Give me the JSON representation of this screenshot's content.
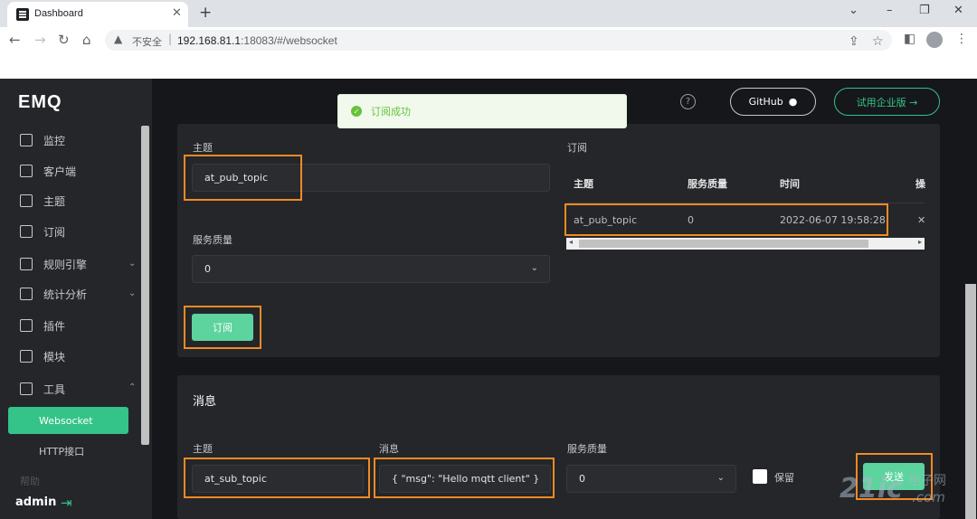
{
  "browser": {
    "tab_title": "Dashboard",
    "tab_close": "✕",
    "new_tab": "+",
    "url_insecure_label": "不安全",
    "url_sep": "|",
    "url_host": "192.168.81.1",
    "url_path": ":18083/#/websocket",
    "icons": [
      "back-icon",
      "forward-icon",
      "reload-icon",
      "home-icon",
      "warning-icon",
      "share-icon",
      "star-icon",
      "sidepanel-icon",
      "profile-icon",
      "menu-icon"
    ]
  },
  "app": {
    "logo": "EMQ",
    "toast": "订阅成功",
    "help": "?",
    "github_label": "GitHub",
    "try_label": "试用企业版 →",
    "sidebar": {
      "items": [
        {
          "label": "监控"
        },
        {
          "label": "客户端"
        },
        {
          "label": "主题"
        },
        {
          "label": "订阅"
        },
        {
          "label": "规则引擎"
        },
        {
          "label": "统计分析"
        },
        {
          "label": "插件"
        },
        {
          "label": "模块"
        },
        {
          "label": "工具"
        }
      ],
      "active": "Websocket",
      "sub": "HTTP接口",
      "faded": "帮助",
      "user": "admin"
    },
    "subscribe": {
      "topic_label": "主题",
      "topic_value": "at_pub_topic",
      "qos_label": "服务质量",
      "qos_value": "0",
      "button": "订阅",
      "table_title": "订阅",
      "columns": [
        "主题",
        "服务质量",
        "时间",
        "操"
      ],
      "rows": [
        {
          "topic": "at_pub_topic",
          "qos": "0",
          "time": "2022-06-07 19:58:28",
          "action": "✕"
        }
      ]
    },
    "message": {
      "section_title": "消息",
      "topic_label": "主题",
      "topic_value": "at_sub_topic",
      "msg_label": "消息",
      "msg_value": "{ \"msg\": \"Hello mqtt client\" }",
      "qos_label": "服务质量",
      "qos_value": "0",
      "retain_label": "保留",
      "send_button": "发送"
    },
    "watermark": {
      "big": "21ic",
      "small": "电子网",
      "domain": ".com"
    }
  },
  "colors": {
    "accent": "#34c388",
    "highlight": "#f08a24",
    "toast_bg": "#f0f9eb"
  }
}
